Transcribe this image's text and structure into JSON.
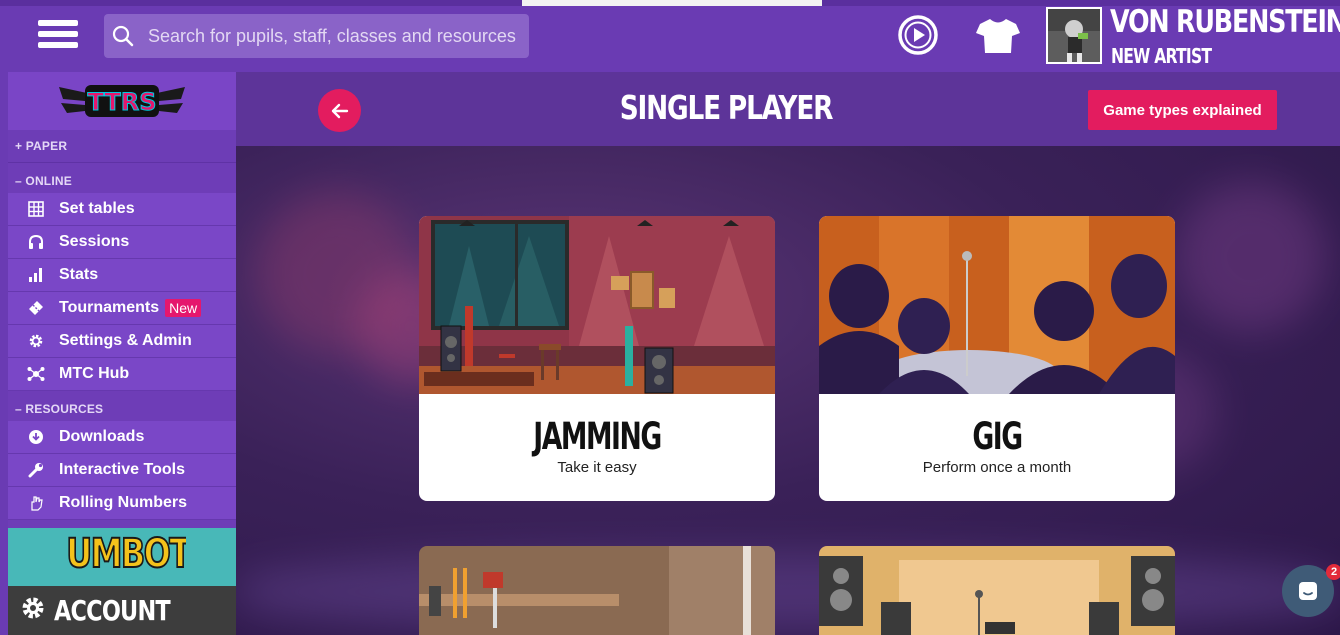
{
  "topbar": {
    "search_placeholder": "Search for pupils, staff, classes and resources",
    "user_name": "VON RUBENSTEIN",
    "user_rank": "NEW ARTIST"
  },
  "sidebar": {
    "logo_text": "TTRS",
    "sections": [
      {
        "header": "+ PAPER",
        "items": []
      },
      {
        "header": "– ONLINE",
        "items": [
          {
            "label": "Set tables",
            "icon": "grid-icon"
          },
          {
            "label": "Sessions",
            "icon": "headphones-icon"
          },
          {
            "label": "Stats",
            "icon": "bar-chart-icon"
          },
          {
            "label": "Tournaments",
            "icon": "ticket-icon",
            "badge": "New"
          },
          {
            "label": "Settings & Admin",
            "icon": "gear-icon"
          },
          {
            "label": "MTC Hub",
            "icon": "hub-icon"
          }
        ]
      },
      {
        "header": "– RESOURCES",
        "items": [
          {
            "label": "Downloads",
            "icon": "download-icon"
          },
          {
            "label": "Interactive Tools",
            "icon": "wrench-icon"
          },
          {
            "label": "Rolling Numbers",
            "icon": "hand-icon"
          }
        ]
      }
    ],
    "numbots_label": "NUMBOTS",
    "account_label": "ACCOUNT"
  },
  "main": {
    "title": "SINGLE PLAYER",
    "explain_button": "Game types explained",
    "cards": [
      {
        "title": "JAMMING",
        "subtitle": "Take it easy"
      },
      {
        "title": "GIG",
        "subtitle": "Perform once a month"
      }
    ]
  },
  "chat": {
    "badge": "2"
  },
  "colors": {
    "topbar": "#6a3bb3",
    "accent_red": "#e31c5f",
    "sidebar": "#7a47c7",
    "numbots": "#48b8b8"
  }
}
